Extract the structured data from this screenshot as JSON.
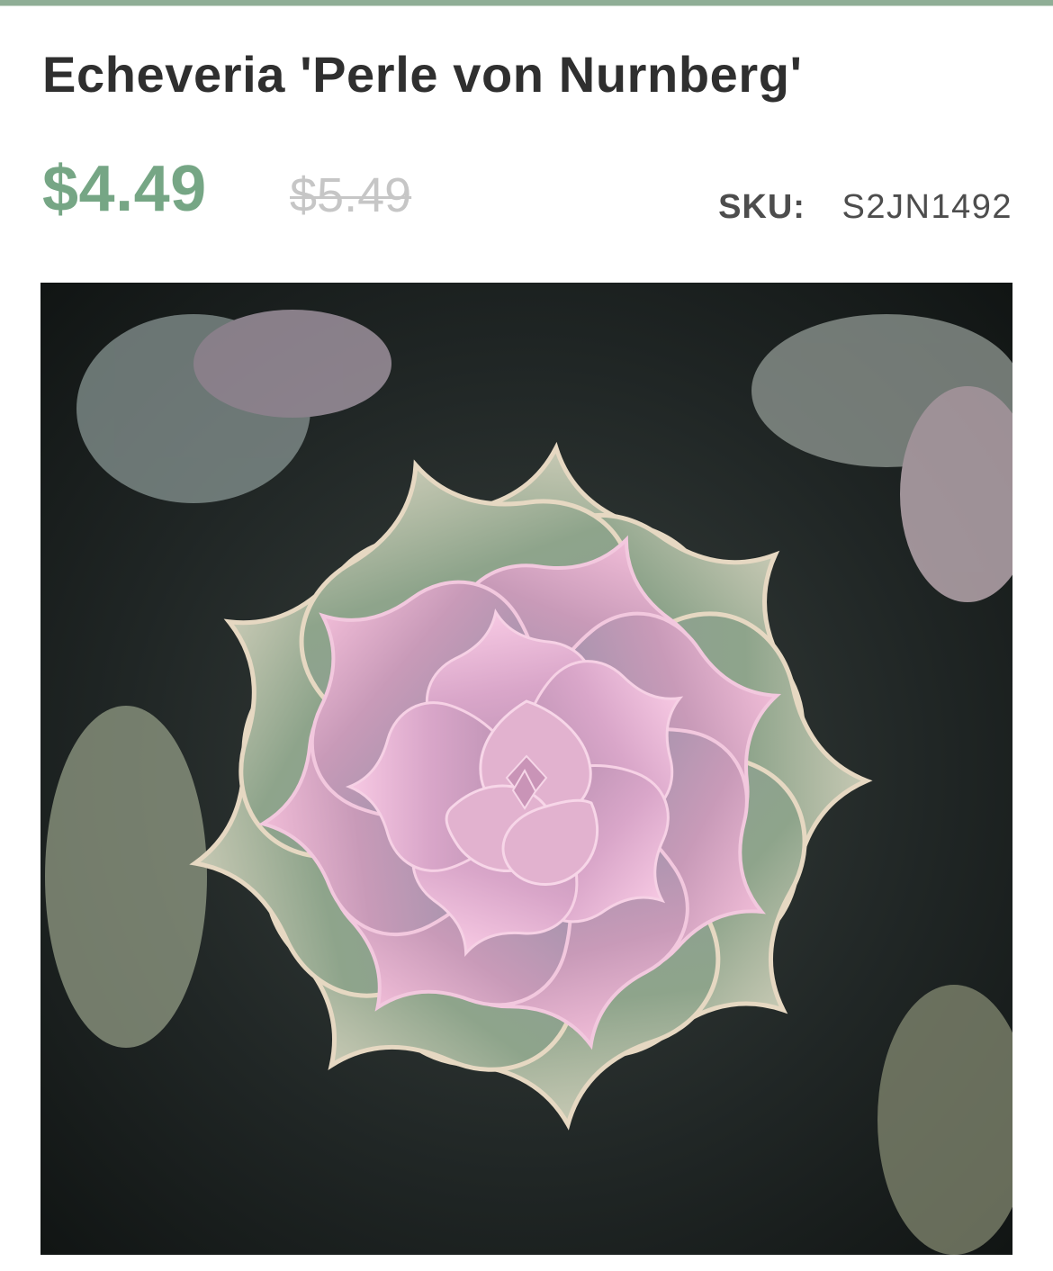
{
  "product": {
    "title": "Echeveria 'Perle von Nurnberg'",
    "price_current": "$4.49",
    "price_original": "$5.49",
    "sku_label": "SKU:",
    "sku_value": "S2JN1492"
  },
  "colors": {
    "accent_green": "#76a685",
    "title_text": "#2f2f2f",
    "strike_price": "#c6c6c6",
    "top_rule": "#8fae96",
    "succulent_pink": "#d6a1c4",
    "succulent_sage": "#92a58d"
  },
  "image": {
    "icon_name": "succulent-photo"
  }
}
